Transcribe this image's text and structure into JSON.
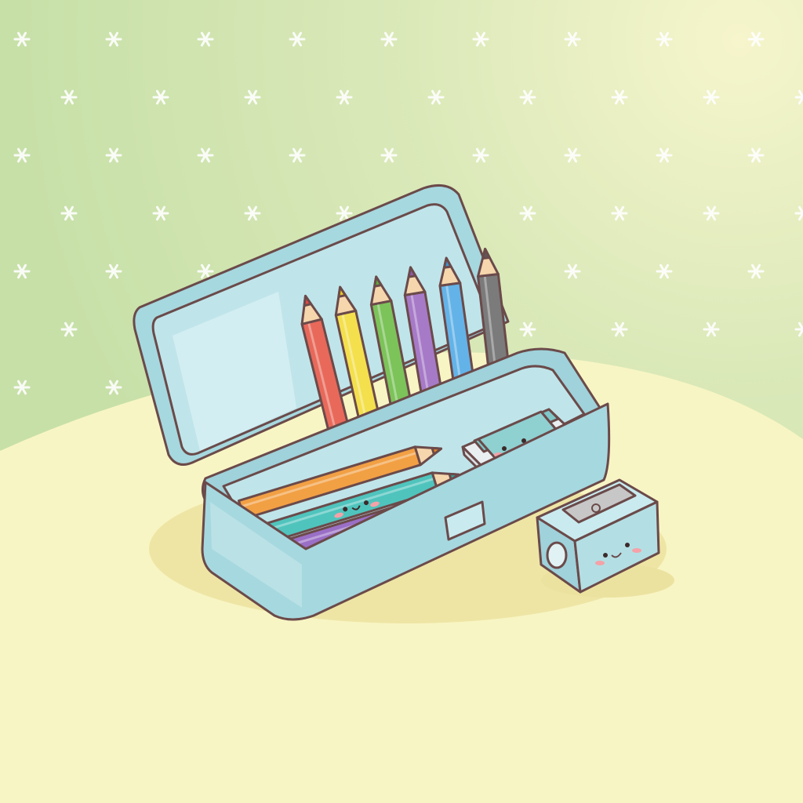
{
  "scene": {
    "subject": "pencil-case-with-colored-pencils",
    "colors": {
      "wall": "#cfe4b0",
      "wall_glow": "#f3f4c8",
      "table": "#f8f5c4",
      "outline": "#6b4a4a",
      "case": "#a6d8df",
      "case_light": "#c9ebef",
      "case_inner": "#bfe5ea",
      "star": "#ffffff",
      "blush": "#f4a2a8"
    },
    "upright_pencils": [
      {
        "color_name": "red",
        "body": "#e8695a",
        "tip": "#e14b43"
      },
      {
        "color_name": "yellow",
        "body": "#f4e04d",
        "tip": "#e9c824"
      },
      {
        "color_name": "green",
        "body": "#7cc35a",
        "tip": "#5da93c"
      },
      {
        "color_name": "purple",
        "body": "#a77ac8",
        "tip": "#8c5bb0"
      },
      {
        "color_name": "blue",
        "body": "#63b3e8",
        "tip": "#3e95d3"
      },
      {
        "color_name": "gray",
        "body": "#7b7b7b",
        "tip": "#5a5a5a"
      }
    ],
    "lying_pencils": [
      {
        "color_name": "orange",
        "body": "#f2a044",
        "tip": "#e58423",
        "face": false
      },
      {
        "color_name": "teal",
        "body": "#4fc4bd",
        "tip": "#2fa79f",
        "face": true
      },
      {
        "color_name": "violet",
        "body": "#9a6fc6",
        "tip": "#7b52ad",
        "face": false
      }
    ],
    "items": [
      "eraser-with-face",
      "pencil-sharpener-with-face"
    ]
  }
}
